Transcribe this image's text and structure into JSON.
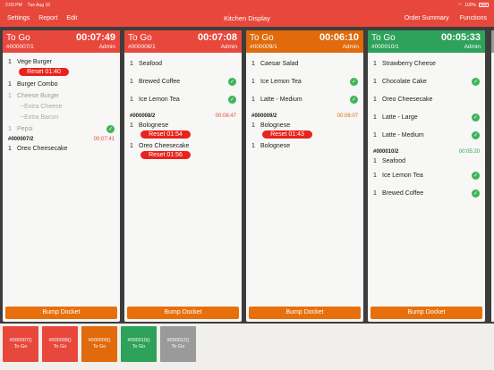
{
  "status": {
    "time": "2:03 PM",
    "date": "Tue Aug 16",
    "battery": "100%"
  },
  "nav": {
    "settings": "Settings",
    "report": "Report",
    "edit": "Edit",
    "title": "Kitchen Display",
    "order_summary": "Order Summary",
    "functions": "Functions"
  },
  "colors": {
    "red": "#e8483c",
    "orange": "#e06a0c",
    "green": "#2ea25a",
    "gray": "#9a9a9a",
    "reset": "#e8231c",
    "check": "#3fb45a"
  },
  "tickets": [
    {
      "type": "To Go",
      "timer": "00:07:49",
      "number": "#000007/1",
      "staff": "Admin",
      "items": [
        {
          "qty": "1",
          "name": "Vege Burger",
          "reset": "Reset 01:40"
        },
        {
          "qty": "1",
          "name": "Burger Combo"
        },
        {
          "qty": "1",
          "name": "Cheese Burger",
          "mods": [
            "~Extra Cheese",
            "~Extra Bacon"
          ]
        },
        {
          "qty": "1",
          "name": "Pepsi"
        }
      ],
      "sub": {
        "number": "#000007/2",
        "time": "00:07:41",
        "items": [
          {
            "qty": "1",
            "name": "Oreo Cheesecake"
          }
        ]
      },
      "bump": "Bump Docket"
    },
    {
      "type": "To Go",
      "timer": "00:07:08",
      "number": "#000008/1",
      "staff": "Admin",
      "items": [
        {
          "qty": "1",
          "name": "Seafood"
        },
        {
          "qty": "1",
          "name": "Brewed Coffee"
        },
        {
          "qty": "1",
          "name": "Ice Lemon Tea"
        }
      ],
      "sub": {
        "number": "#000008/2",
        "time": "00:06:47",
        "items": [
          {
            "qty": "1",
            "name": "Bolognese",
            "reset": "Reset 01:54"
          },
          {
            "qty": "1",
            "name": "Oreo Cheesecake",
            "reset": "Reset 01:56"
          }
        ]
      },
      "bump": "Bump Docket"
    },
    {
      "type": "To Go",
      "timer": "00:06:10",
      "number": "#000009/1",
      "staff": "Admin",
      "items": [
        {
          "qty": "1",
          "name": "Caesar Salad"
        },
        {
          "qty": "1",
          "name": "Ice Lemon Tea"
        },
        {
          "qty": "1",
          "name": "Latte - Medium"
        }
      ],
      "sub": {
        "number": "#000009/2",
        "time": "00:06:07",
        "items": [
          {
            "qty": "1",
            "name": "Bolognese",
            "reset": "Reset 01:43"
          },
          {
            "qty": "1",
            "name": "Bolognese"
          }
        ]
      },
      "bump": "Bump Docket"
    },
    {
      "type": "To Go",
      "timer": "00:05:33",
      "number": "#000010/1",
      "staff": "Admin",
      "items": [
        {
          "qty": "1",
          "name": "Strawberry Cheese"
        },
        {
          "qty": "1",
          "name": "Chocolate Cake"
        },
        {
          "qty": "1",
          "name": "Oreo Cheesecake"
        },
        {
          "qty": "1",
          "name": "Latte - Large"
        },
        {
          "qty": "1",
          "name": "Latte - Medium"
        }
      ],
      "sub": {
        "number": "#000010/2",
        "time": "00:05:20",
        "items": [
          {
            "qty": "1",
            "name": "Seafood"
          },
          {
            "qty": "1",
            "name": "Ice Lemon Tea"
          },
          {
            "qty": "1",
            "name": "Brewed Coffee"
          }
        ]
      },
      "bump": "Bump Docket"
    }
  ],
  "tray": [
    {
      "number": "#000007()",
      "label": "To Go",
      "color": "#e8483c"
    },
    {
      "number": "#000008()",
      "label": "To Go",
      "color": "#e8483c"
    },
    {
      "number": "#000009()",
      "label": "To Go",
      "color": "#e06a0c"
    },
    {
      "number": "#000010()",
      "label": "To Go",
      "color": "#2ea25a"
    },
    {
      "number": "#000012()",
      "label": "To Go",
      "color": "#9a9a9a"
    }
  ]
}
